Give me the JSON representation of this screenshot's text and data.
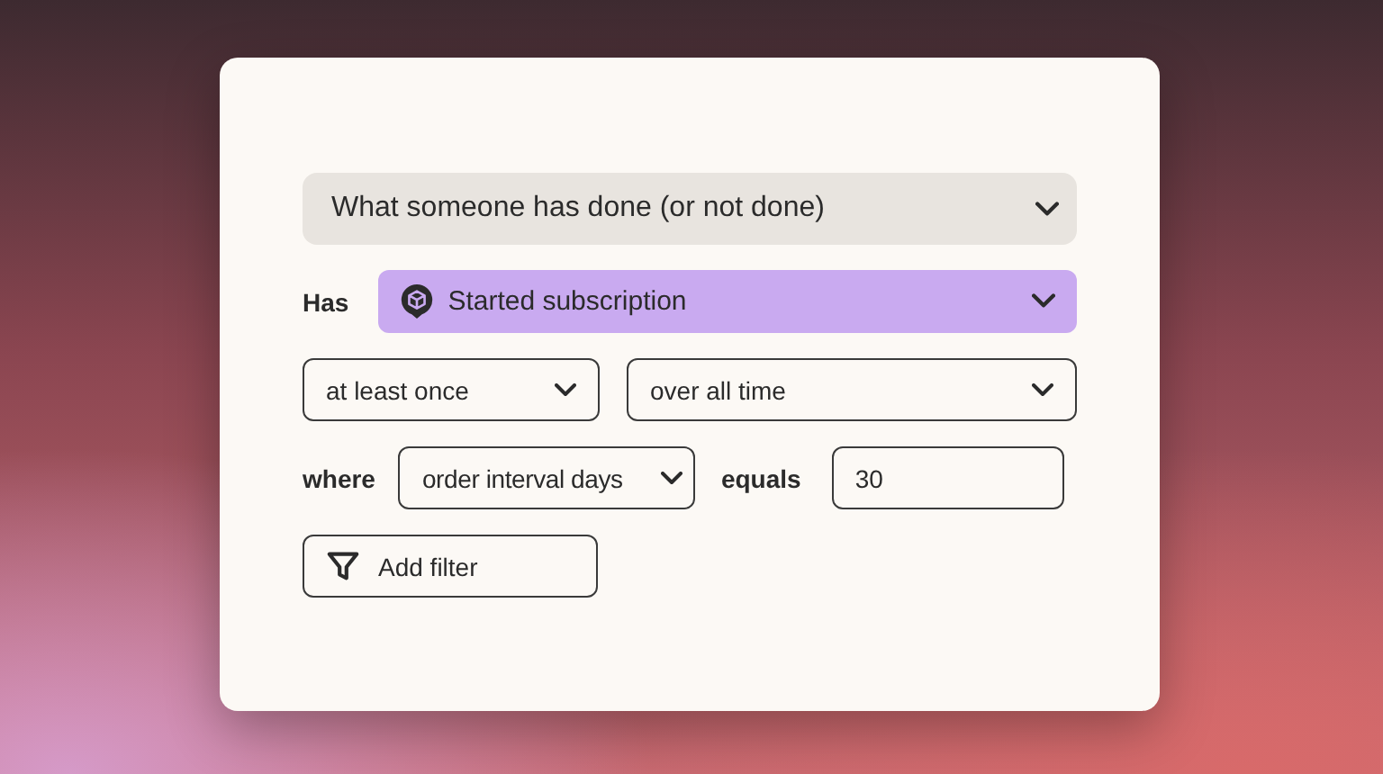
{
  "condition_select": {
    "value": "What someone has done (or not done)"
  },
  "event": {
    "label": "Has",
    "value": "Started subscription"
  },
  "frequency": {
    "value": "at least once"
  },
  "timeframe": {
    "value": "over all time"
  },
  "filter": {
    "label": "where",
    "property": "order interval days",
    "operator": "equals",
    "value": "30"
  },
  "add_filter_button": {
    "label": "Add filter"
  }
}
